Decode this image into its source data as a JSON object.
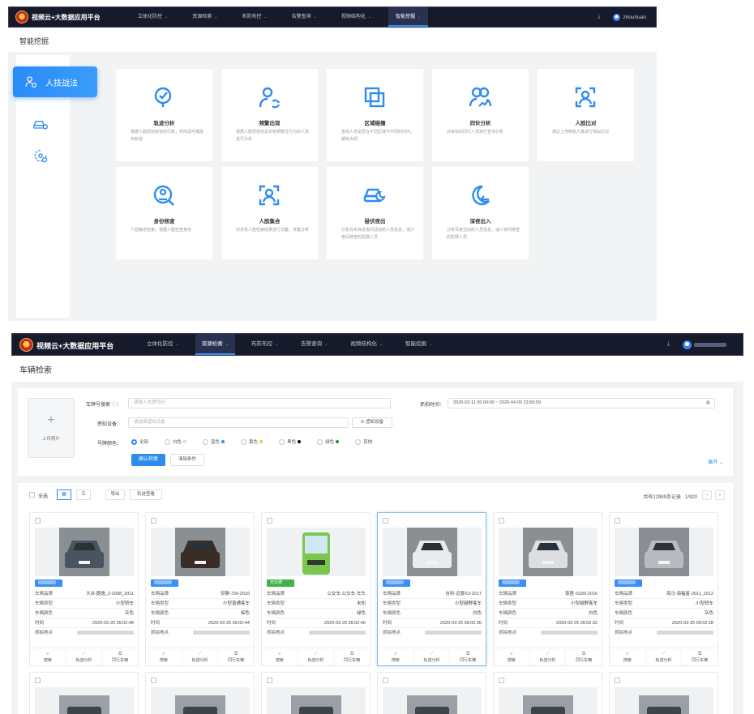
{
  "panel1": {
    "brand": "视频云+大数据应用平台",
    "menu": [
      {
        "label": "立体化防控"
      },
      {
        "label": "资源检索"
      },
      {
        "label": "布防布控"
      },
      {
        "label": "告警查询"
      },
      {
        "label": "视频结构化"
      },
      {
        "label": "智能挖掘",
        "active": true
      }
    ],
    "username": "zhouhuan",
    "page_title": "智能挖掘",
    "sidebar": {
      "active_label": "人技战法",
      "icons": [
        "person-sync-icon",
        "car-search-icon",
        "location-search-icon"
      ]
    },
    "cards": [
      {
        "title": "轨迹分析",
        "desc": "根据人脸抓拍目标的行踪，并形成可播放的轨迹",
        "icon": "trajectory-icon"
      },
      {
        "title": "频繁出现",
        "desc": "根据人脸抓拍信息对有频繁往行为的人员进行分析",
        "icon": "frequent-person-icon"
      },
      {
        "title": "区域碰撞",
        "desc": "查找人员是否在不同区域与不同时间内，都有出现",
        "icon": "area-collision-icon"
      },
      {
        "title": "同伙分析",
        "desc": "对目标的同行人员进行查询分析",
        "icon": "companion-icon"
      },
      {
        "title": "人脸比对",
        "desc": "通过上传两张人像进行相似比对",
        "icon": "face-compare-icon"
      },
      {
        "title": "身份核查",
        "desc": "人脸静态检索，根据人脸检查身份",
        "icon": "identity-check-icon"
      },
      {
        "title": "人脸集合",
        "desc": "对多张人脸检索结果进行交集、并集分析",
        "icon": "face-set-icon"
      },
      {
        "title": "昼伏夜出",
        "desc": "分析白天休息夜间活动的人员信息，减少夜间排查的犯罪人员",
        "icon": "day-night-car-icon"
      },
      {
        "title": "深夜出入",
        "desc": "分析深夜活动的人员信息，减少夜间排查的犯罪人员",
        "icon": "late-night-icon"
      }
    ]
  },
  "panel2": {
    "brand": "视频云+大数据应用平台",
    "menu": [
      {
        "label": "立体化防控"
      },
      {
        "label": "资源检索",
        "active": true
      },
      {
        "label": "布防布控"
      },
      {
        "label": "告警查询"
      },
      {
        "label": "视频结构化"
      },
      {
        "label": "智能挖掘"
      }
    ],
    "page_title": "车辆检索",
    "filter": {
      "upload_label": "上传照片",
      "plate_label": "车牌号搜索",
      "plate_placeholder": "请输入车牌号码",
      "time_label": "抓拍时间：",
      "time_value": "2020-03-11 00:00:00 ~ 2020-04-09 23:59:59",
      "device_label": "感知设备：",
      "device_placeholder": "请选择感知设备",
      "device_button": "感知设备",
      "color_label": "号牌颜色：",
      "colors": [
        {
          "label": "全部",
          "selected": true,
          "dot": ""
        },
        {
          "label": "白色",
          "dot": "#ffffff"
        },
        {
          "label": "蓝色",
          "dot": "#3a8ef6"
        },
        {
          "label": "黄色",
          "dot": "#f5c542"
        },
        {
          "label": "黑色",
          "dot": "#000000"
        },
        {
          "label": "绿色",
          "dot": "#1a9b2a"
        },
        {
          "label": "其他",
          "dot": ""
        }
      ],
      "confirm_button": "确认检索",
      "clear_button": "清除条件",
      "expand_label": "展开"
    },
    "results": {
      "select_all": "全选",
      "export_button": "导出",
      "trajectory_button": "轨迹查看",
      "total_text": "共有22989条记录",
      "page_text": "1/920",
      "labels": {
        "brand": "车辆品牌",
        "type": "车辆类型",
        "color": "车辆颜色",
        "time": "时间",
        "place": "抓拍地点"
      },
      "actions": [
        "搜索",
        "轨迹分析",
        "同行车辆"
      ],
      "items": [
        {
          "plate": "",
          "plate_color": "blue",
          "brand": "大众-朗逸_2-2008_2011",
          "type": "小型轿车",
          "color": "灰色",
          "time": "2020-03-25 09:02:48",
          "car_color": "#4a5360"
        },
        {
          "plate": "",
          "plate_color": "blue",
          "brand": "安騏-730-2016",
          "type": "小型普通客车",
          "color": "棕色",
          "time": "2020-03-25 09:02:44",
          "car_color": "#3a2c26"
        },
        {
          "plate": "无车牌",
          "plate_color": "green",
          "brand": "公交车-公交车-车头",
          "type": "未知",
          "color": "绿色",
          "time": "2020-03-25 09:02:40",
          "car_color": "#7bc64e"
        },
        {
          "plate": "",
          "plate_color": "blue",
          "brand": "吉利-远景X3-2017",
          "type": "小型越野客车",
          "color": "白色",
          "time": "2020-03-25 09:02:36",
          "car_color": "#e8eaee",
          "selected": true
        },
        {
          "plate": "",
          "plate_color": "blue",
          "brand": "取胜-S330-2016",
          "type": "小型越野客车",
          "color": "白色",
          "time": "2020-03-25 09:02:32",
          "car_color": "#dcdee2"
        },
        {
          "plate": "",
          "plate_color": "blue",
          "brand": "海马-海福星-2011_2012",
          "type": "小型轿车",
          "color": "灰色",
          "time": "2020-03-25 09:02:28",
          "car_color": "#b8bcc2"
        }
      ]
    }
  }
}
